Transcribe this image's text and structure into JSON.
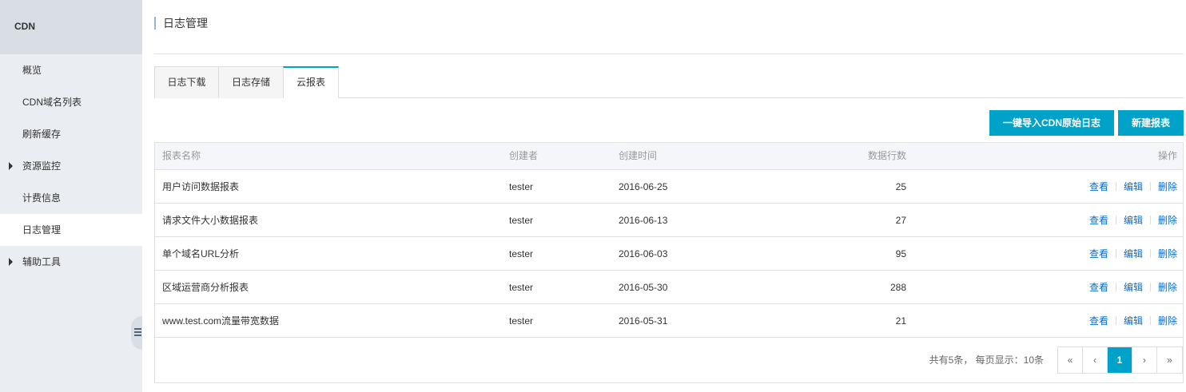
{
  "sidebar": {
    "title": "CDN",
    "items": [
      {
        "label": "概览",
        "expandable": false,
        "active": false
      },
      {
        "label": "CDN域名列表",
        "expandable": false,
        "active": false
      },
      {
        "label": "刷新缓存",
        "expandable": false,
        "active": false
      },
      {
        "label": "资源监控",
        "expandable": true,
        "active": false
      },
      {
        "label": "计费信息",
        "expandable": false,
        "active": false
      },
      {
        "label": "日志管理",
        "expandable": false,
        "active": true
      },
      {
        "label": "辅助工具",
        "expandable": true,
        "active": false
      }
    ]
  },
  "page": {
    "title": "日志管理"
  },
  "tabs": [
    {
      "label": "日志下载",
      "active": false
    },
    {
      "label": "日志存储",
      "active": false
    },
    {
      "label": "云报表",
      "active": true
    }
  ],
  "toolbar": {
    "import_label": "一键导入CDN原始日志",
    "new_label": "新建报表"
  },
  "table": {
    "headers": {
      "name": "报表名称",
      "creator": "创建者",
      "time": "创建时间",
      "rows": "数据行数",
      "ops": "操作"
    },
    "ops_labels": {
      "view": "查看",
      "edit": "编辑",
      "delete": "删除"
    },
    "rows": [
      {
        "name": "用户访问数据报表",
        "creator": "tester",
        "time": "2016-06-25",
        "rows": "25"
      },
      {
        "name": "请求文件大小数据报表",
        "creator": "tester",
        "time": "2016-06-13",
        "rows": "27"
      },
      {
        "name": "单个域名URL分析",
        "creator": "tester",
        "time": "2016-06-03",
        "rows": "95"
      },
      {
        "name": "区域运营商分析报表",
        "creator": "tester",
        "time": "2016-05-30",
        "rows": "288"
      },
      {
        "name": "www.test.com流量带宽数据",
        "creator": "tester",
        "time": "2016-05-31",
        "rows": "21"
      }
    ]
  },
  "pagination": {
    "info": "共有5条， 每页显示：10条",
    "first": "«",
    "prev": "‹",
    "current": "1",
    "next": "›",
    "last": "»"
  },
  "colors": {
    "accent": "#00a2ca",
    "link": "#0a6cc9",
    "sidebar_bg": "#eaedf1"
  }
}
